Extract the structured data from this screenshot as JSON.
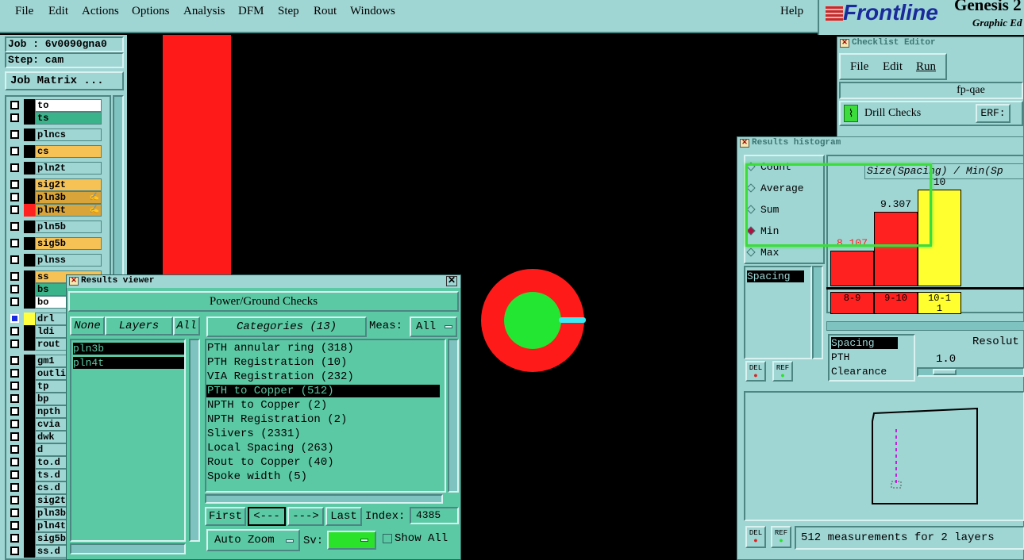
{
  "menubar": {
    "items": [
      "File",
      "Edit",
      "Actions",
      "Options",
      "Analysis",
      "DFM",
      "Step",
      "Rout",
      "Windows"
    ],
    "help": "Help",
    "brand": "Frontline",
    "app_title": "Genesis 2",
    "app_subtitle": "Graphic Ed"
  },
  "job": {
    "job_label": "Job : 6v0090gna0",
    "step_label": "Step: cam",
    "matrix_button": "Job Matrix ..."
  },
  "layers": [
    {
      "name": "to",
      "color": "#ffffff",
      "swatch": ""
    },
    {
      "name": "ts",
      "color": "#3bb38a",
      "swatch": ""
    },
    {
      "name": "plncs",
      "color": "#9fd6d4",
      "swatch": ""
    },
    {
      "name": "cs",
      "color": "#f7c255",
      "swatch": ""
    },
    {
      "name": "pln2t",
      "color": "#9fd6d4",
      "swatch": ""
    },
    {
      "name": "sig2t",
      "color": "#f7c255",
      "swatch": ""
    },
    {
      "name": "pln3b",
      "color": "#d9a43a",
      "swatch": "",
      "mark": "✍"
    },
    {
      "name": "pln4t",
      "color": "#d9a43a",
      "swatch": "#ff2020",
      "mark": "✍"
    },
    {
      "name": "pln5b",
      "color": "#9fd6d4",
      "swatch": ""
    },
    {
      "name": "sig5b",
      "color": "#f7c255",
      "swatch": ""
    },
    {
      "name": "plnss",
      "color": "#9fd6d4",
      "swatch": ""
    },
    {
      "name": "ss",
      "color": "#f7c255",
      "swatch": ""
    },
    {
      "name": "bs",
      "color": "#3bb38a",
      "swatch": ""
    },
    {
      "name": "bo",
      "color": "#ffffff",
      "swatch": ""
    },
    {
      "name": "drl",
      "color": "#9fd6d4",
      "swatch": "#ffff40",
      "selected": true
    },
    {
      "name": "ldi",
      "color": "#9fd6d4",
      "swatch": ""
    },
    {
      "name": "rout",
      "color": "#9fd6d4",
      "swatch": ""
    },
    {
      "name": "gm1",
      "color": "#9fd6d4",
      "swatch": ""
    },
    {
      "name": "outli",
      "color": "#9fd6d4",
      "swatch": ""
    },
    {
      "name": "tp",
      "color": "#9fd6d4",
      "swatch": ""
    },
    {
      "name": "bp",
      "color": "#9fd6d4",
      "swatch": ""
    },
    {
      "name": "npth",
      "color": "#9fd6d4",
      "swatch": ""
    },
    {
      "name": "cvia",
      "color": "#9fd6d4",
      "swatch": ""
    },
    {
      "name": "dwk",
      "color": "#9fd6d4",
      "swatch": ""
    },
    {
      "name": "d",
      "color": "#9fd6d4",
      "swatch": ""
    },
    {
      "name": "to.d",
      "color": "#9fd6d4",
      "swatch": ""
    },
    {
      "name": "ts.d",
      "color": "#9fd6d4",
      "swatch": ""
    },
    {
      "name": "cs.d",
      "color": "#9fd6d4",
      "swatch": ""
    },
    {
      "name": "sig2t",
      "color": "#9fd6d4",
      "swatch": ""
    },
    {
      "name": "pln3b",
      "color": "#9fd6d4",
      "swatch": ""
    },
    {
      "name": "pln4t",
      "color": "#9fd6d4",
      "swatch": ""
    },
    {
      "name": "sig5b",
      "color": "#9fd6d4",
      "swatch": ""
    },
    {
      "name": "ss.d",
      "color": "#9fd6d4",
      "swatch": ""
    }
  ],
  "results_viewer": {
    "title": "Results viewer",
    "heading": "Power/Ground Checks",
    "none_label": "None",
    "layers_label": "Layers",
    "all_label": "All",
    "layer_items": [
      "pln3b",
      "pln4t"
    ],
    "categories_label": "Categories (13)",
    "meas_label": "Meas:",
    "meas_value": "All",
    "categories": [
      "PTH annular ring (318)",
      "PTH Registration (10)",
      "VIA Registration (232)",
      "PTH to Copper (512)",
      "NPTH to Copper (2)",
      "NPTH Registration (2)",
      "Slivers (2331)",
      "Local Spacing (263)",
      "Rout to Copper (40)",
      "Spoke width (5)"
    ],
    "selected_category": 3,
    "first_label": "First",
    "prev_label": "<---",
    "next_label": "--->",
    "last_label": "Last",
    "index_label": "Index:",
    "index_value": "4385",
    "auto_zoom_label": "Auto Zoom",
    "sv_label": "Sv:",
    "show_all_label": "Show All"
  },
  "checklist_editor": {
    "title": "Checklist Editor",
    "menu": [
      "File",
      "Edit",
      "Run"
    ],
    "name": "fp-qae",
    "check_label": "Drill Checks",
    "erf_label": "ERF:"
  },
  "histogram": {
    "title": "Results histogram",
    "modes": [
      "Count",
      "Average",
      "Sum",
      "Min",
      "Max"
    ],
    "selected_mode": "Min",
    "attr_list": [
      "Spacing"
    ],
    "header": "Size(Spacing) / Min(Sp",
    "bottom_list": [
      "Spacing",
      "PTH",
      "Clearance"
    ],
    "resolution_label": "Resolut",
    "resolution_value": "1.0",
    "status": "512 measurements for 2 layers",
    "del_label": "DEL",
    "ref_label": "REF"
  },
  "chart_data": {
    "type": "bar",
    "categories": [
      "8-9",
      "9-10",
      "10-11"
    ],
    "values": [
      8.107,
      9.307,
      10
    ],
    "value_labels": [
      "8.107",
      "9.307",
      "10"
    ],
    "ylabel": "",
    "title": "Size(Spacing) / Min(Sp",
    "colors": [
      "#ff2020",
      "#ff2020",
      "#ffff30"
    ],
    "label_colors": [
      "#ff2020",
      "#000000",
      "#000000"
    ]
  },
  "colors": {
    "panel": "#9fd6d4",
    "panel_green": "#5cc9a5",
    "canvas": "#000000",
    "highlight": "#3ddc3d"
  }
}
